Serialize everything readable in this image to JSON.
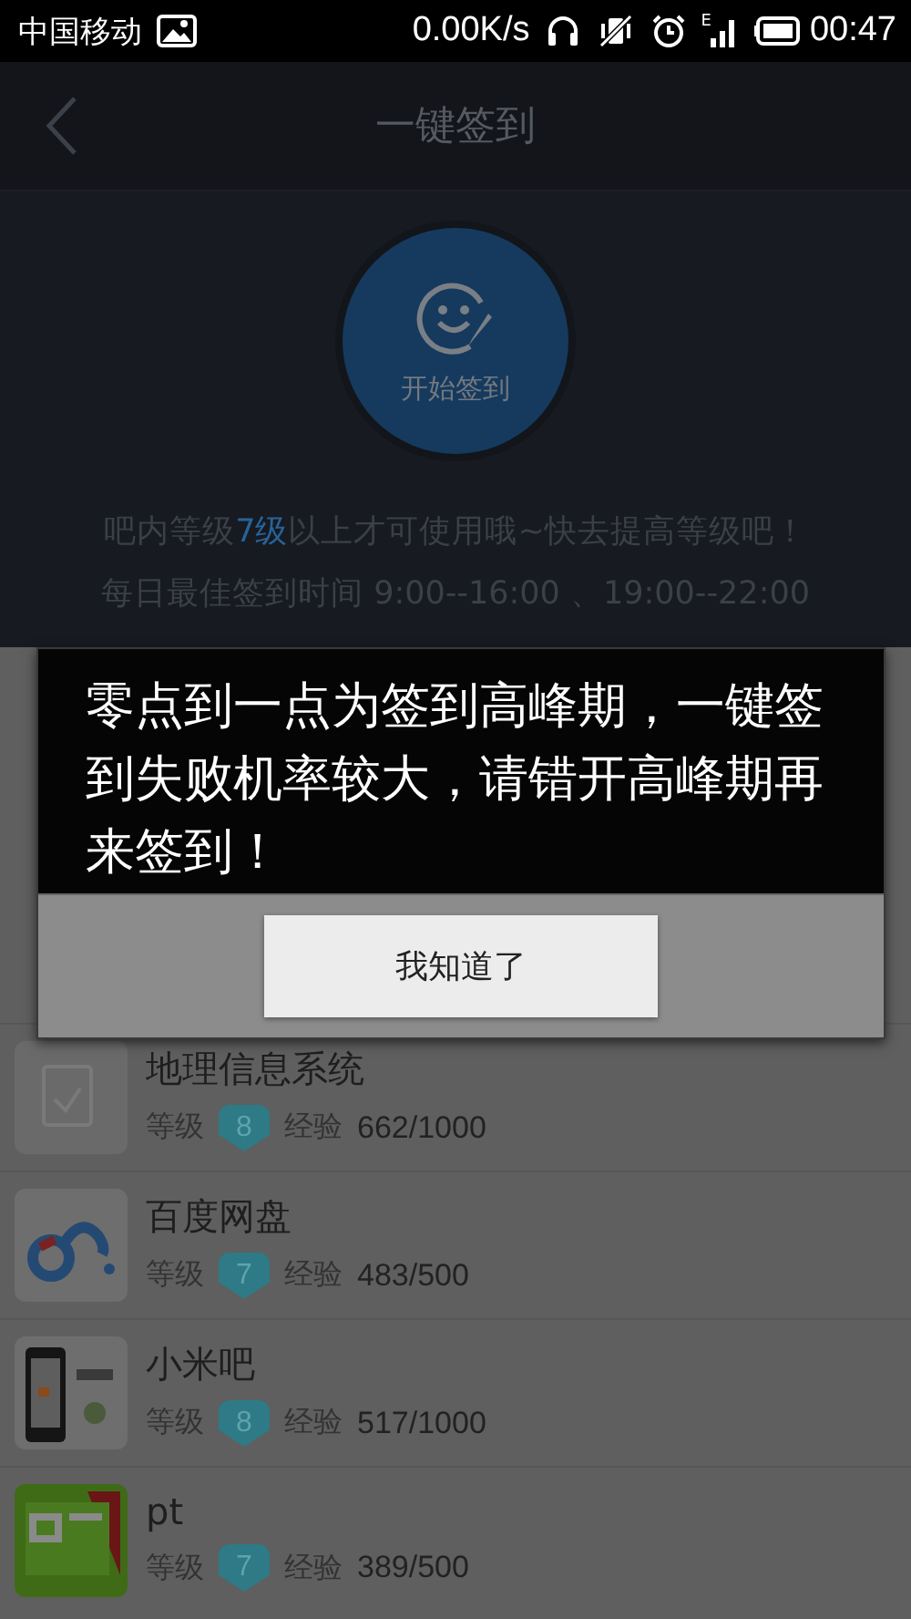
{
  "status_bar": {
    "carrier": "中国移动",
    "speed": "0.00K/s",
    "network": "E",
    "time": "00:47"
  },
  "nav": {
    "title": "一键签到"
  },
  "sign_in": {
    "button": "开始签到",
    "note": {
      "before": "吧内等级",
      "highlight": "7级",
      "after": "以上才可使用哦~快去提高等级吧！"
    },
    "best_time": "每日最佳签到时间  9:00--16:00 、19:00--22:00"
  },
  "forums": [
    {
      "name": "地理信息系统",
      "rank_label": "等级",
      "rank": "8",
      "exp_label": "经验",
      "exp": "662/1000"
    },
    {
      "name": "百度网盘",
      "rank_label": "等级",
      "rank": "7",
      "exp_label": "经验",
      "exp": "483/500"
    },
    {
      "name": "小米吧",
      "rank_label": "等级",
      "rank": "8",
      "exp_label": "经验",
      "exp": "517/1000"
    },
    {
      "name": "pt",
      "rank_label": "等级",
      "rank": "7",
      "exp_label": "经验",
      "exp": "389/500"
    }
  ],
  "dialog": {
    "message": "零点到一点为签到高峰期，一键签到失败机率较大，请错开高峰期再来签到！",
    "button": "我知道了"
  }
}
